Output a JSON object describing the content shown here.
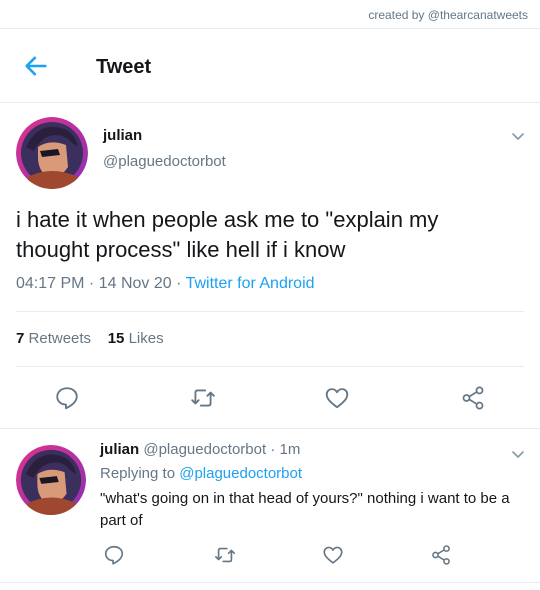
{
  "credit": "created by @thearcanatweets",
  "header": {
    "title": "Tweet"
  },
  "tweet": {
    "name": "julian",
    "handle": "@plaguedoctorbot",
    "text": "i hate it when people ask me to \"explain my thought process\" like hell if i know",
    "time": "04:17 PM",
    "date": "14 Nov 20",
    "source": "Twitter for Android",
    "retweets_count": "7",
    "retweets_label": "Retweets",
    "likes_count": "15",
    "likes_label": "Likes"
  },
  "reply": {
    "name": "julian",
    "handle": "@plaguedoctorbot",
    "age": "1m",
    "replying_prefix": "Replying to",
    "replying_to": "@plaguedoctorbot",
    "text": "\"what's going on in that head of yours?\" nothing i want to be a part of"
  },
  "colors": {
    "accent": "#1da1f2",
    "muted": "#657786",
    "divider": "#e6ecf0",
    "icon": "#657786"
  },
  "icons": [
    "back-arrow-icon",
    "chevron-down-icon",
    "reply-icon",
    "retweet-icon",
    "like-icon",
    "share-icon"
  ]
}
